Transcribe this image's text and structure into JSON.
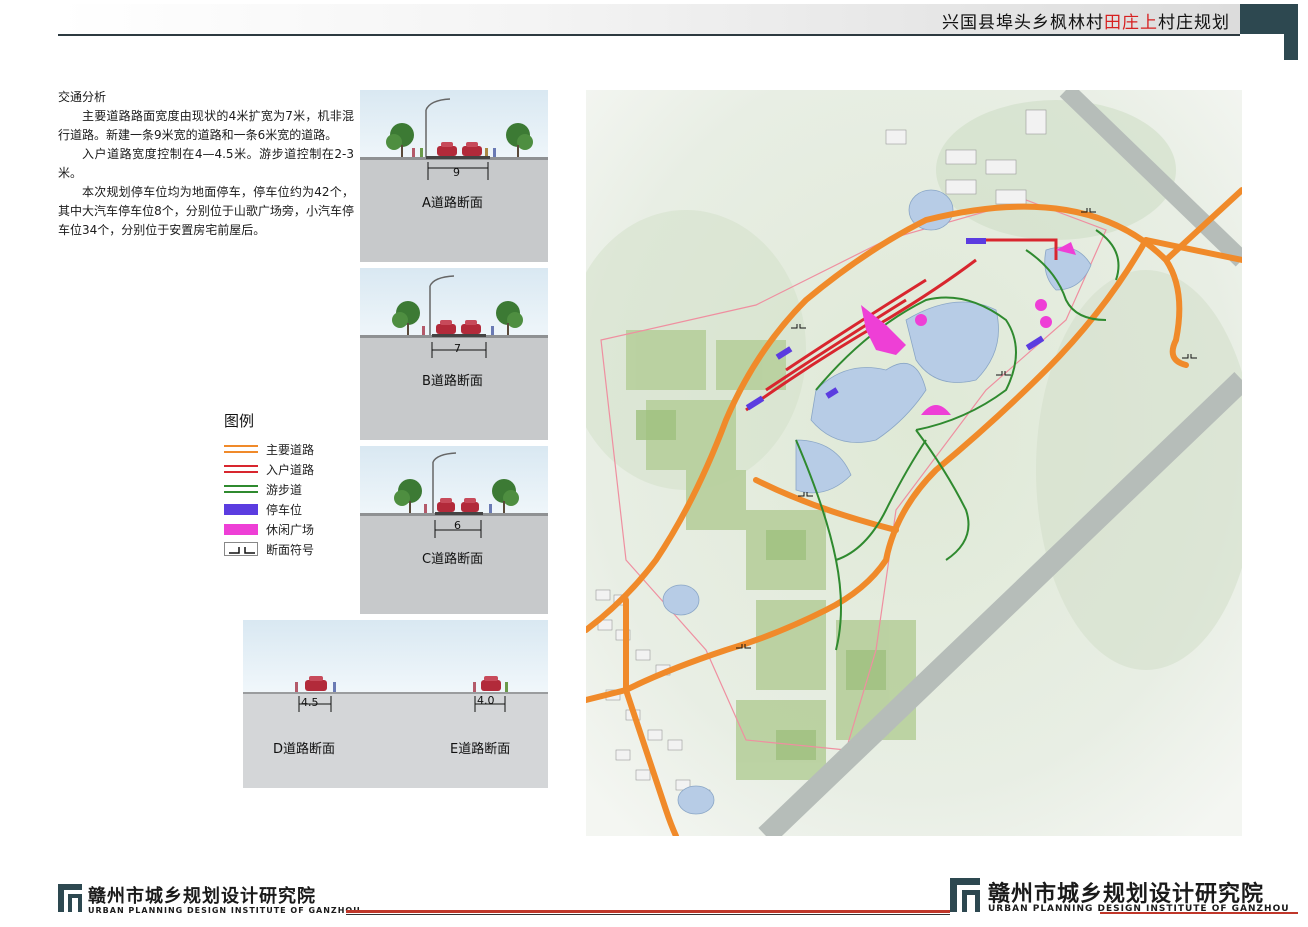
{
  "header": {
    "title_pre": "兴国县埠头乡枫林村",
    "title_hl": "田庄上",
    "title_post": "村庄规划"
  },
  "intro": {
    "title": "交通分析",
    "p1": "主要道路路面宽度由现状的4米扩宽为7米，机非混行道路。新建一条9米宽的道路和一条6米宽的道路。",
    "p2": "入户道路宽度控制在4—4.5米。游步道控制在2-3米。",
    "p3": "本次规划停车位均为地面停车，停车位约为42个，其中大汽车停车位8个，分别位于山歌广场旁，小汽车停车位34个，分别位于安置房宅前屋后。"
  },
  "sections": {
    "a": {
      "label": "A道路断面",
      "width": "9"
    },
    "b": {
      "label": "B道路断面",
      "width": "7"
    },
    "c": {
      "label": "C道路断面",
      "width": "6"
    },
    "d": {
      "label": "D道路断面",
      "width": "4.5"
    },
    "e": {
      "label": "E道路断面",
      "width": "4.0"
    }
  },
  "legend": {
    "title": "图例",
    "items": [
      {
        "label": "主要道路",
        "color": "#f08a2a",
        "kind": "double-line"
      },
      {
        "label": "入户道路",
        "color": "#d8262e",
        "kind": "double-line"
      },
      {
        "label": "游步道",
        "color": "#2f8a2f",
        "kind": "double-line"
      },
      {
        "label": "停车位",
        "color": "#5b3ce0",
        "kind": "fill"
      },
      {
        "label": "休闲广场",
        "color": "#ee3fd6",
        "kind": "fill"
      },
      {
        "label": "断面符号",
        "color": "#111111",
        "kind": "symbol"
      }
    ]
  },
  "footer": {
    "left": {
      "cn": "赣州市城乡规划设计研究院",
      "en": "URBAN PLANNING DESIGN INSTITUTE OF GANZHOU"
    },
    "right": {
      "cn": "赣州市城乡规划设计研究院",
      "en": "URBAN PLANNING DESIGN INSTITUTE OF GANZHOU"
    }
  }
}
